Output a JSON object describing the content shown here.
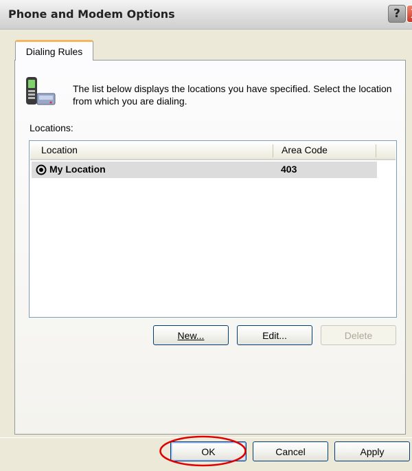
{
  "window": {
    "title": "Phone and Modem Options",
    "help_button": "?",
    "close_button": "X"
  },
  "tabs": [
    {
      "label": "Dialing Rules",
      "selected": true
    }
  ],
  "dialing_rules": {
    "description": "The list below displays the locations you have specified. Select the location from which you are dialing.",
    "locations_label": "Locations:",
    "columns": [
      "Location",
      "Area Code"
    ],
    "rows": [
      {
        "location": "My Location",
        "area_code": "403",
        "selected": true
      }
    ],
    "buttons": {
      "new": "New...",
      "edit": "Edit...",
      "delete": "Delete"
    }
  },
  "footer": {
    "ok": "OK",
    "cancel": "Cancel",
    "apply": "Apply"
  },
  "icons": {
    "phone": "phone-modem-icon",
    "radio": "radio-selected-icon"
  },
  "colors": {
    "annotation_ellipse": "#e00000",
    "tab_highlight": "#f3b65a",
    "button_border": "#003c74"
  }
}
